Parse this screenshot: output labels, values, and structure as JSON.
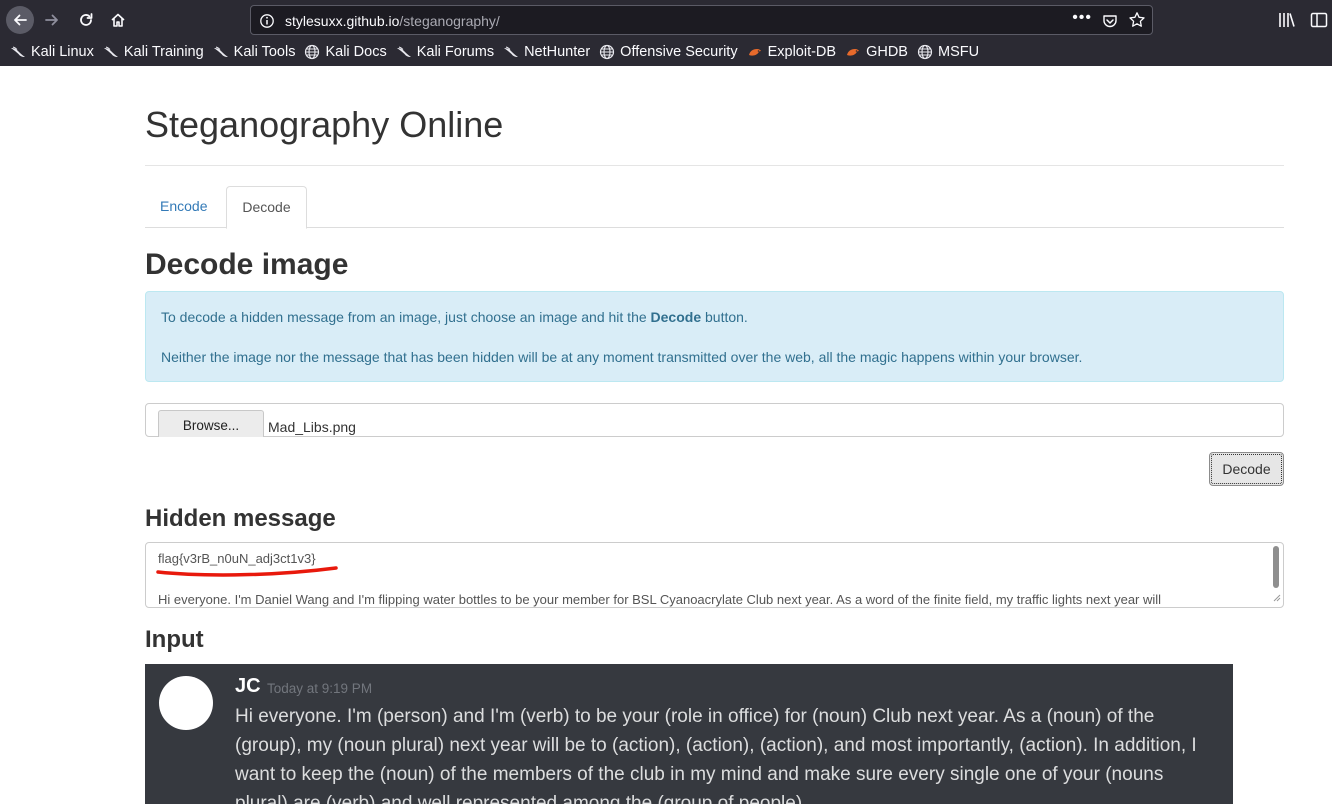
{
  "browser": {
    "url_host": "stylesuxx.github.io",
    "url_path": "/steganography/",
    "url_menu_label": "•••",
    "bookmarks": [
      {
        "label": "Kali Linux",
        "icon": "kali-dragon-icon"
      },
      {
        "label": "Kali Training",
        "icon": "kali-dragon-icon"
      },
      {
        "label": "Kali Tools",
        "icon": "kali-dragon-icon"
      },
      {
        "label": "Kali Docs",
        "icon": "globe-icon"
      },
      {
        "label": "Kali Forums",
        "icon": "kali-dragon-icon"
      },
      {
        "label": "NetHunter",
        "icon": "kali-dragon-icon"
      },
      {
        "label": "Offensive Security",
        "icon": "globe-icon"
      },
      {
        "label": "Exploit-DB",
        "icon": "exploitdb-icon"
      },
      {
        "label": "GHDB",
        "icon": "exploitdb-icon"
      },
      {
        "label": "MSFU",
        "icon": "globe-icon"
      }
    ]
  },
  "page": {
    "title": "Steganography Online",
    "tabs": [
      {
        "label": "Encode",
        "active": false
      },
      {
        "label": "Decode",
        "active": true
      }
    ],
    "section_title": "Decode image",
    "alert": {
      "line1_before": "To decode a hidden message from an image, just choose an image and hit the",
      "line1_bold": "Decode",
      "line1_after": "button.",
      "line2": "Neither the image nor the message that has been hidden will be at any moment transmitted over the web, all the magic happens within your browser."
    },
    "file_input": {
      "browse_label": "Browse...",
      "file_name": "Mad_Libs.png"
    },
    "decode_button": "Decode",
    "hidden_message_title": "Hidden message",
    "hidden_message": {
      "line1": "flag{v3rB_n0uN_adj3ct1v3}",
      "line2": "Hi everyone. I'm Daniel Wang and I'm flipping water bottles to be your member for BSL Cyanoacrylate Club next year. As a word of the finite field, my traffic lights next year will"
    },
    "input_title": "Input"
  },
  "discord": {
    "username": "JC",
    "timestamp": "Today at 9:19 PM",
    "message": "Hi everyone. I'm (person) and I'm (verb) to be your (role in office) for (noun) Club next year. As a (noun) of the (group), my (noun plural) next year will be to (action), (action), (action), and most importantly, (action). In addition, I want to keep the (noun) of the members of the club in my mind and make sure every single one of your (nouns plural) are (verb) and well represented among the (group of people)."
  },
  "colors": {
    "chrome_bg": "#2b2a33",
    "link": "#337ab7",
    "alert_bg": "#d9edf7",
    "alert_text": "#31708f",
    "annotation_underline": "#e8190c",
    "discord_bg": "#36393f"
  }
}
